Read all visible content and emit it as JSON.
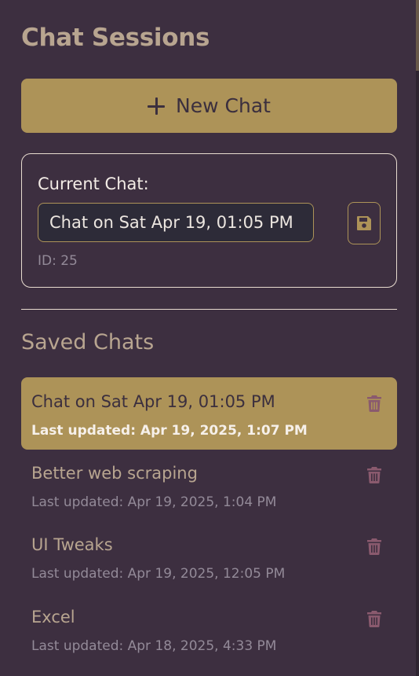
{
  "sidebar": {
    "title": "Chat Sessions",
    "new_chat_label": "New Chat"
  },
  "current_chat": {
    "label": "Current Chat:",
    "name_value": "Chat on Sat Apr 19, 01:05 PM",
    "id_text": "ID: 25"
  },
  "saved": {
    "heading": "Saved Chats",
    "items": [
      {
        "name": "Chat on Sat Apr 19, 01:05 PM",
        "updated": "Last updated: Apr 19, 2025, 1:07 PM",
        "active": true
      },
      {
        "name": "Better web scraping",
        "updated": "Last updated: Apr 19, 2025, 1:04 PM",
        "active": false
      },
      {
        "name": "UI Tweaks",
        "updated": "Last updated: Apr 19, 2025, 12:05 PM",
        "active": false
      },
      {
        "name": "Excel",
        "updated": "Last updated: Apr 18, 2025, 4:33 PM",
        "active": false
      }
    ]
  },
  "icons": {
    "new_chat": "plus-icon",
    "save": "save-icon",
    "delete": "trash-icon"
  },
  "colors": {
    "background": "#3d2f40",
    "accent": "#ad9358",
    "delete_icon": "#8a5a6e"
  }
}
